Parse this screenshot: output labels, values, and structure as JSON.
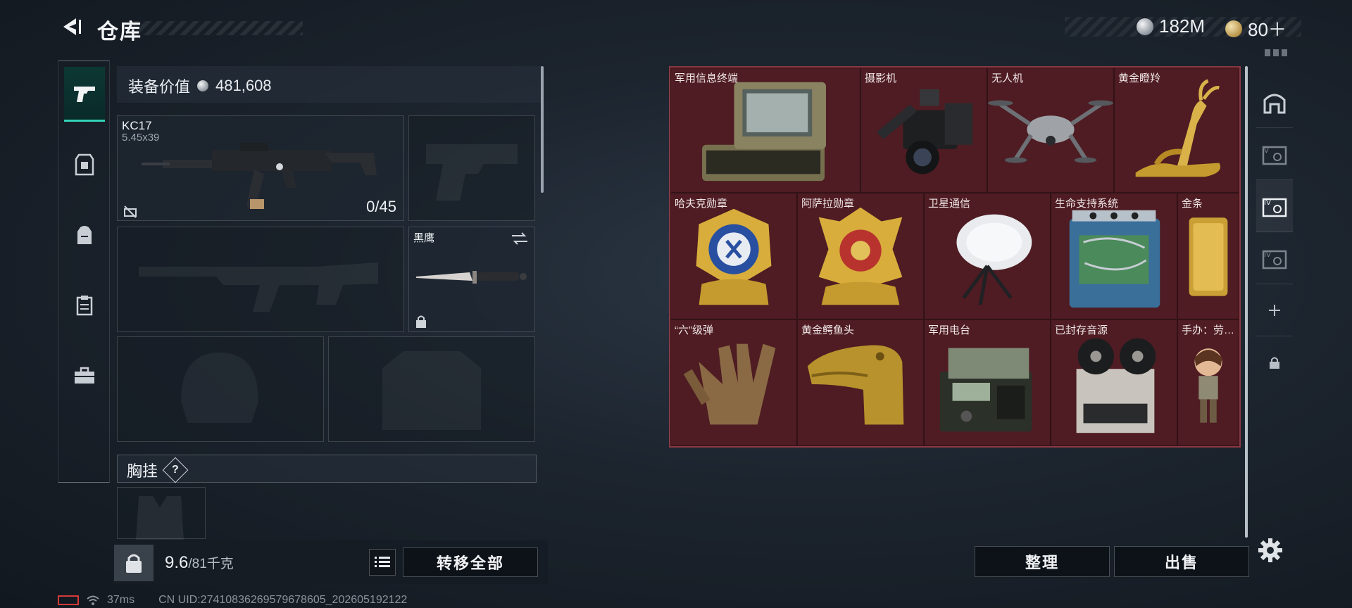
{
  "header": {
    "title": "仓库",
    "currencies": [
      {
        "icon": "silver-coin-icon",
        "value": "182M"
      },
      {
        "icon": "gold-coin-icon",
        "value": "80＋"
      }
    ]
  },
  "left_panel": {
    "equip_value_label": "装备价值",
    "equip_value": "481,608",
    "slots": {
      "primary": {
        "name": "KC17",
        "caliber": "5.45x39",
        "ammo": "0/45"
      },
      "melee": {
        "name": "黑鹰"
      }
    },
    "chest_rig_label": "胸挂",
    "chest_rig_help": "?",
    "weight_current": "9.6",
    "weight_max": "/81千克",
    "transfer_all": "转移全部"
  },
  "grid_items": [
    {
      "name": "军用信息终端",
      "icon": "rugged-terminal-icon"
    },
    {
      "name": "摄影机",
      "icon": "video-camera-icon"
    },
    {
      "name": "无人机",
      "icon": "drone-icon"
    },
    {
      "name": "黄金瞪羚",
      "icon": "golden-gazelle-icon"
    },
    {
      "name": "哈夫克勋章",
      "icon": "haavk-medal-icon"
    },
    {
      "name": "阿萨拉勋章",
      "icon": "asala-medal-icon"
    },
    {
      "name": "卫星通信",
      "icon": "satellite-dish-icon"
    },
    {
      "name": "生命支持系统",
      "icon": "life-support-icon"
    },
    {
      "name": "金条",
      "icon": "gold-bar-icon"
    },
    {
      "name": "“六”级弹",
      "icon": "six-finger-bullet-icon"
    },
    {
      "name": "黄金鳄鱼头",
      "icon": "golden-crocodile-icon"
    },
    {
      "name": "军用电台",
      "icon": "military-radio-icon"
    },
    {
      "name": "已封存音源",
      "icon": "reel-to-reel-icon"
    },
    {
      "name": "手办：劳…",
      "icon": "figurine-icon"
    }
  ],
  "actions": {
    "sort": "整理",
    "sell": "出售"
  },
  "status": {
    "ping": "37ms",
    "uid": "CN UID:27410836269579678605_202605192122"
  },
  "colors": {
    "accent": "#32d3b8",
    "grid_bg": "#5b1f26"
  }
}
